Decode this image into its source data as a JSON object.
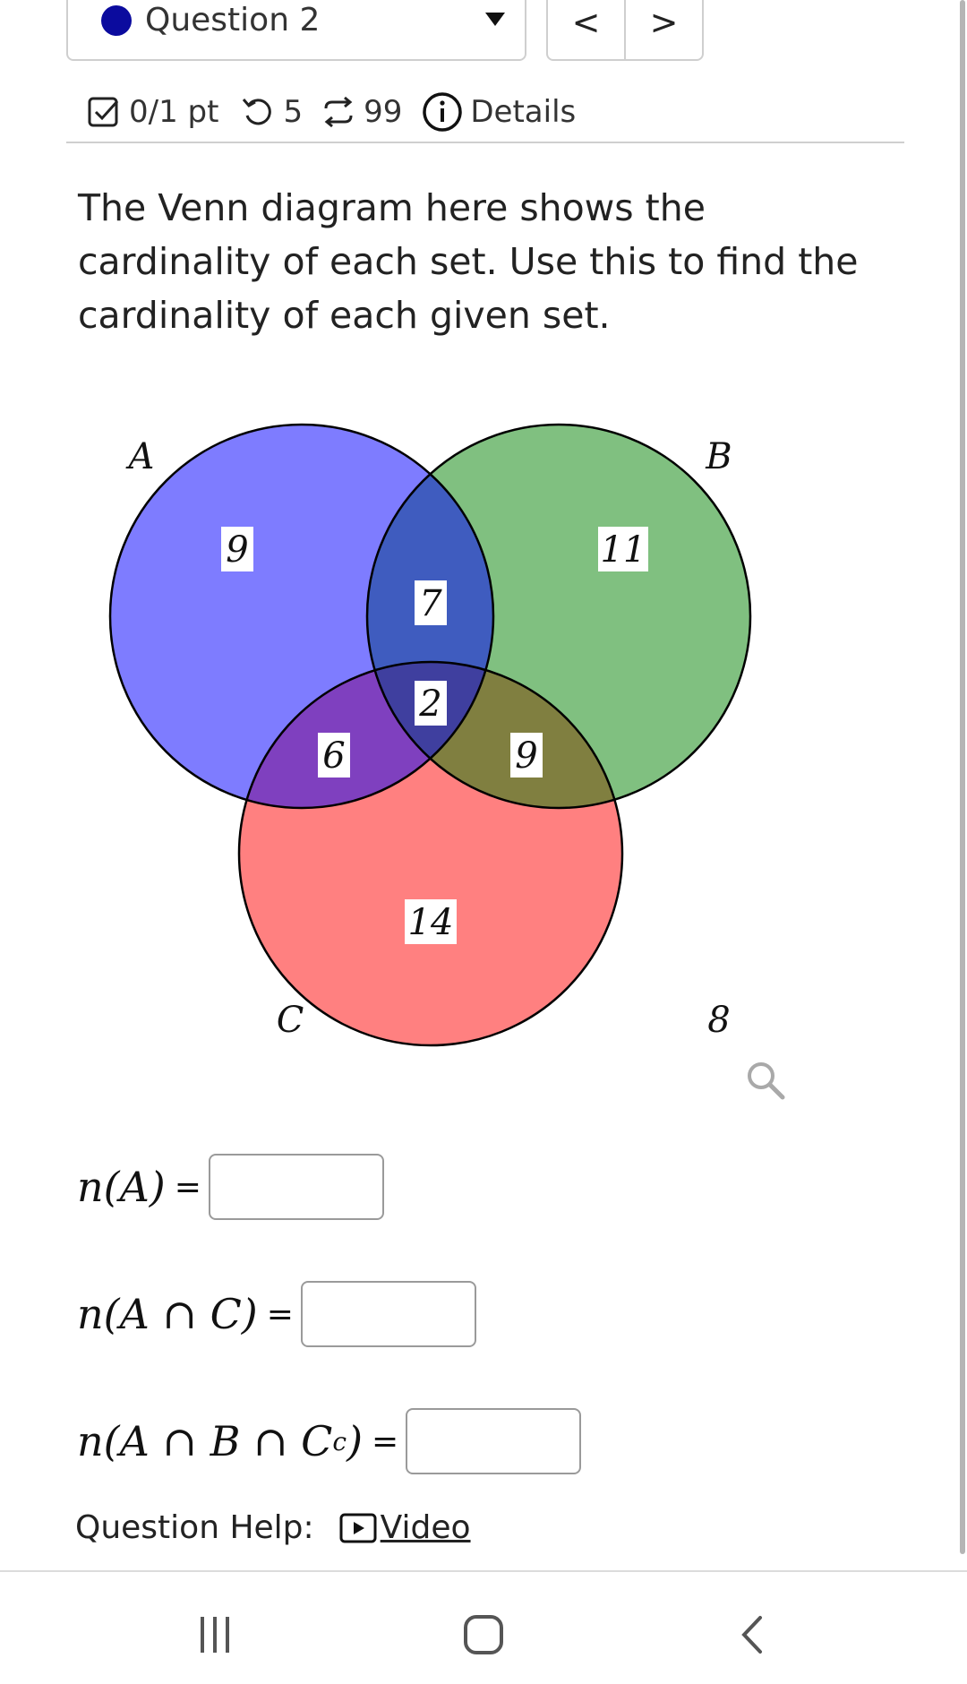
{
  "header": {
    "question_label": "Question 2",
    "prev_label": "<",
    "next_label": ">"
  },
  "status": {
    "score": "0/1 pt",
    "retries": "5",
    "attempts": "99",
    "details_label": "Details"
  },
  "prompt": "The Venn diagram here shows the cardinality of each set. Use this to find the cardinality of each given set.",
  "venn": {
    "set_labels": {
      "A": "A",
      "B": "B",
      "C": "C"
    },
    "region_values": {
      "A_only": "9",
      "B_only": "11",
      "A_B_only": "7",
      "A_B_C": "2",
      "A_C_only": "6",
      "B_C_only": "9",
      "C_only": "14",
      "outside": "8"
    },
    "colors": {
      "A": "#7e7cff",
      "B": "#80c080",
      "C": "#ff8080"
    }
  },
  "equations": [
    {
      "lhs_main": "n(A ∩ C)",
      "sup": ""
    },
    {
      "lhs_main": "n(A ∩ B ∩ C",
      "sup": "c"
    }
  ],
  "eq_first": "n(A)",
  "eq_sign": "=",
  "help": {
    "label": "Question Help:",
    "video_label": "Video"
  }
}
